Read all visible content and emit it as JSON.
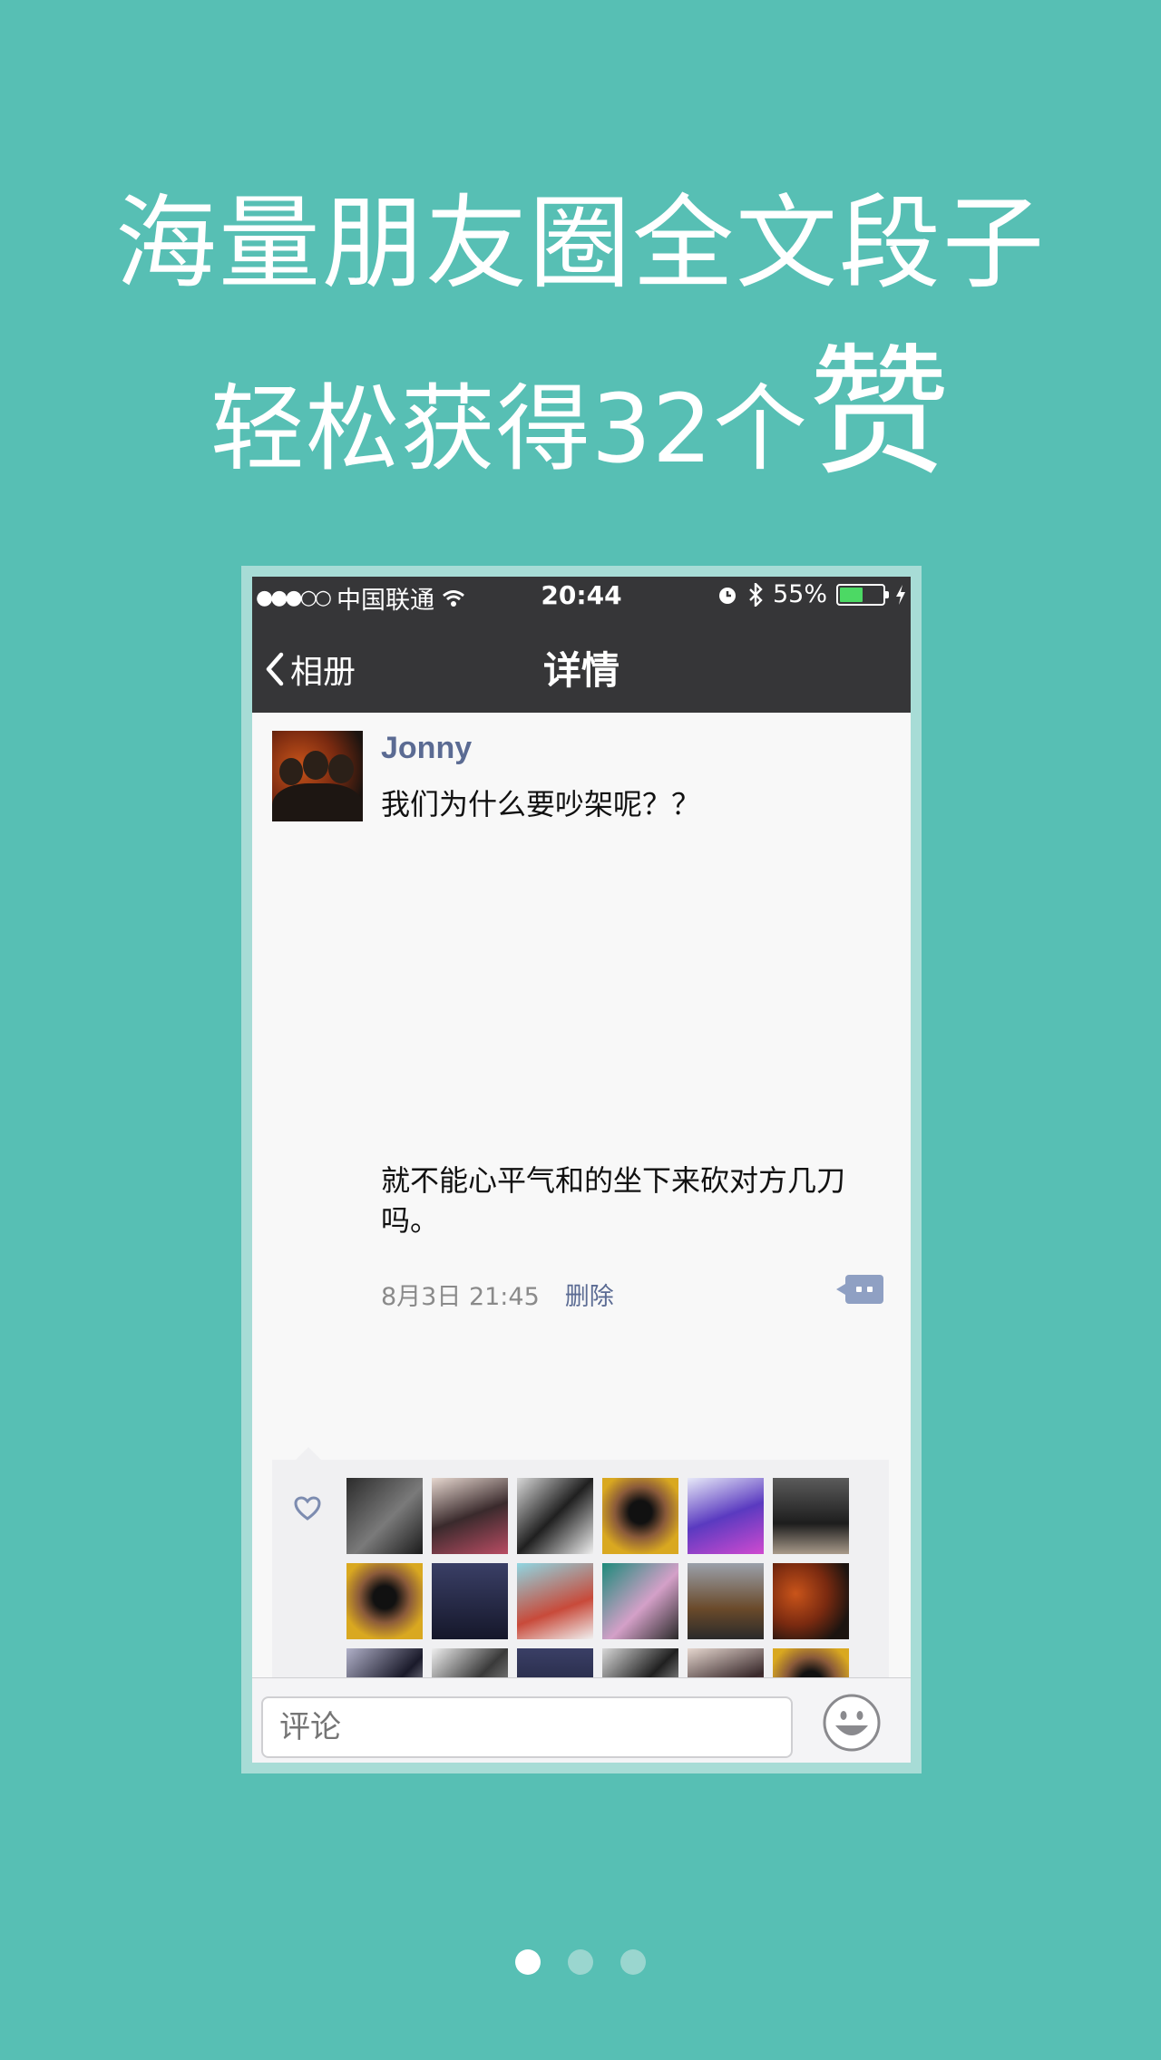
{
  "headline": {
    "line1": "海量朋友圈全文段子",
    "line2_prefix": "轻松获得32个",
    "line2_emphasis": "赞"
  },
  "status_bar": {
    "signal": "●●●○○",
    "carrier": "中国联通",
    "time": "20:44",
    "battery_percent": "55%",
    "battery_level": 0.55
  },
  "nav": {
    "back_label": "相册",
    "title": "详情"
  },
  "post": {
    "username": "Jonny",
    "text_line1": "我们为什么要吵架呢？？",
    "text_line2": "就不能心平气和的坐下来砍对方几刀吗。",
    "timestamp": "8月3日 21:45",
    "delete_label": "删除"
  },
  "likes": {
    "count": 20,
    "thumbs": [
      {
        "bg": "linear-gradient(135deg,#2b2b2b,#7a7a7a 55%,#1b1b1b)"
      },
      {
        "bg": "linear-gradient(160deg,#e6d7cf,#3a2a2c 50%,#b84c63)"
      },
      {
        "bg": "linear-gradient(135deg,#d8d8d8,#202020 50%,#efefef)"
      },
      {
        "bg": "radial-gradient(circle at 50% 45%,#111 20%,#8a5a3a 45%,#d9a820 75%)"
      },
      {
        "bg": "linear-gradient(160deg,#e7e9f8,#5a3ac0 50%,#d04ad0)"
      },
      {
        "bg": "linear-gradient(180deg,#5b5b5b,#1d1d1d 60%,#a89a8a)"
      },
      {
        "bg": "radial-gradient(circle at 50% 45%,#111 20%,#8a5a3a 45%,#d9a820 75%)"
      },
      {
        "bg": "linear-gradient(180deg,#3a3f66,#15172a)"
      },
      {
        "bg": "linear-gradient(160deg,#8fd6e2,#c84a3a 60%,#f0f0f0)"
      },
      {
        "bg": "linear-gradient(135deg,#1d8a7a,#d4a0c8 55%,#2a2a2a)"
      },
      {
        "bg": "linear-gradient(180deg,#9aa0aa,#6a4a2a 60%,#2a2a2a)"
      },
      {
        "bg": "radial-gradient(circle at 30% 40%,#c9541a,#7a2a10 45%,#1c1410 80%)"
      },
      {
        "bg": "linear-gradient(135deg,#b0b0c8,#1a1a2a 55%,#e8e8f0)"
      },
      {
        "bg": "linear-gradient(135deg,#efefef,#3a3a3a 50%,#bdbdbd)"
      },
      {
        "bg": "linear-gradient(180deg,#3a3f66,#15172a)"
      },
      {
        "bg": "linear-gradient(135deg,#d8d8d8,#202020 50%,#efefef)"
      },
      {
        "bg": "linear-gradient(160deg,#e6d7cf,#3a2a2c 50%,#b84c63)"
      },
      {
        "bg": "radial-gradient(circle at 50% 45%,#111 20%,#8a5a3a 45%,#d9a820 75%)"
      },
      {
        "bg": "linear-gradient(160deg,#7a9a5a,#2a1a14 50%,#c89a7a)"
      },
      {
        "bg": "linear-gradient(135deg,#f0f0f0,#5a5a5a 50%,#cfcfcf)"
      }
    ]
  },
  "comment_bar": {
    "placeholder": "评论"
  },
  "pager": {
    "pages": 3,
    "active_index": 0
  },
  "colors": {
    "background": "#57bfb4",
    "topbar": "#363638",
    "link": "#5b6b93",
    "battery": "#4cd964"
  },
  "icons": [
    "back-chevron-icon",
    "wifi-icon",
    "alarm-icon",
    "bluetooth-icon",
    "battery-icon",
    "charging-icon",
    "comment-more-icon",
    "heart-icon",
    "emoji-icon"
  ]
}
